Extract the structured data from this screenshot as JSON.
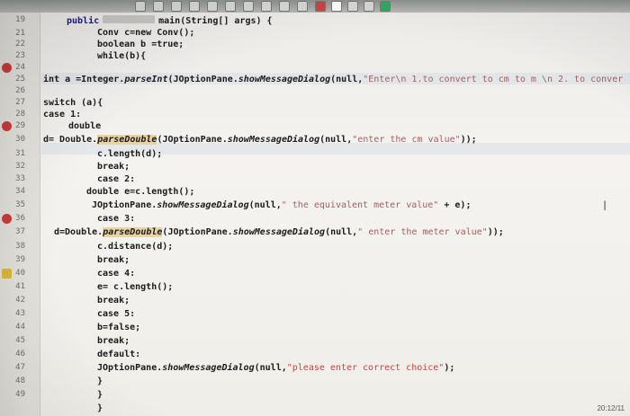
{
  "editor": {
    "lines": [
      {
        "num": "19",
        "text": "",
        "marker": "none"
      },
      {
        "num": "21",
        "text": "",
        "marker": "none"
      },
      {
        "num": "22",
        "text": "",
        "marker": "none"
      },
      {
        "num": "23",
        "text": "",
        "marker": "none"
      },
      {
        "num": "24",
        "text": "",
        "marker": "error"
      },
      {
        "num": "25",
        "text": "",
        "marker": "none"
      },
      {
        "num": "26",
        "text": "",
        "marker": "none"
      },
      {
        "num": "27",
        "text": "",
        "marker": "none"
      },
      {
        "num": "28",
        "text": "",
        "marker": "none"
      },
      {
        "num": "29",
        "text": "",
        "marker": "error"
      },
      {
        "num": "30",
        "text": "",
        "marker": "none"
      },
      {
        "num": "31",
        "text": "",
        "marker": "none"
      },
      {
        "num": "32",
        "text": "",
        "marker": "none"
      },
      {
        "num": "33",
        "text": "",
        "marker": "none"
      },
      {
        "num": "34",
        "text": "",
        "marker": "none"
      },
      {
        "num": "35",
        "text": "",
        "marker": "none"
      },
      {
        "num": "36",
        "text": "",
        "marker": "error"
      },
      {
        "num": "37",
        "text": "",
        "marker": "none"
      },
      {
        "num": "38",
        "text": "",
        "marker": "none"
      },
      {
        "num": "39",
        "text": "",
        "marker": "none"
      },
      {
        "num": "40",
        "text": "",
        "marker": "fix"
      },
      {
        "num": "41",
        "text": "",
        "marker": "none"
      },
      {
        "num": "42",
        "text": "",
        "marker": "none"
      },
      {
        "num": "43",
        "text": "",
        "marker": "none"
      },
      {
        "num": "44",
        "text": "",
        "marker": "none"
      },
      {
        "num": "45",
        "text": "",
        "marker": "none"
      },
      {
        "num": "46",
        "text": "",
        "marker": "none"
      },
      {
        "num": "47",
        "text": "",
        "marker": "none"
      },
      {
        "num": "48",
        "text": "",
        "marker": "none"
      },
      {
        "num": "49",
        "text": "",
        "marker": "none"
      }
    ],
    "code": {
      "l20_public": "public",
      "l20_main": "main(String[] args) {",
      "l21": "Conv c=new Conv();",
      "l22": "boolean b =true;",
      "l23": "while(b){",
      "l24_a": "int a =Integer.",
      "l24_parseInt": "parseInt",
      "l24_b": "(JOptionPane.",
      "l24_show": "showMessageDialog",
      "l24_c": "(null,",
      "l24_str": "\"Enter\\n 1.to convert to cm to m \\n 2. to conver",
      "l26": "switch (a){",
      "l27": "case 1:",
      "l28": "double",
      "l29_a": "d= Double.",
      "l29_parse": "parseDouble",
      "l29_b": "(JOptionPane.",
      "l29_show": "showMessageDialog",
      "l29_c": "(null,",
      "l29_str": "\"enter the cm value\"",
      "l29_d": "));",
      "l30": "c.length(d);",
      "l31": "break;",
      "l32": "case 2:",
      "l33": "double e=c.length();",
      "l34_a": "JOptionPane.",
      "l34_show": "showMessageDialog",
      "l34_b": "(null,",
      "l34_str": "\" the equivalent meter value\"",
      "l34_c": " + e);",
      "l35": "case 3:",
      "l36_a": "d=Double.",
      "l36_parse": "parseDouble",
      "l36_b": "(JOptionPane.",
      "l36_show": "showMessageDialog",
      "l36_c": "(null,",
      "l36_str": "\" enter the meter value\"",
      "l36_d": "));",
      "l37": "c.distance(d);",
      "l38": "break;",
      "l39": "case 4:",
      "l40": "e= c.length();",
      "l41": "break;",
      "l42": "case 5:",
      "l43": "b=false;",
      "l44": "break;",
      "l45": "default:",
      "l46_a": "JOptionPane.",
      "l46_show": "showMessageDialog",
      "l46_b": "(null,",
      "l46_str": "\"please enter correct choice\"",
      "l46_c": ");",
      "l47": "}",
      "l48": "}",
      "l49": "}"
    }
  },
  "status": {
    "clock": "20:12/11"
  }
}
